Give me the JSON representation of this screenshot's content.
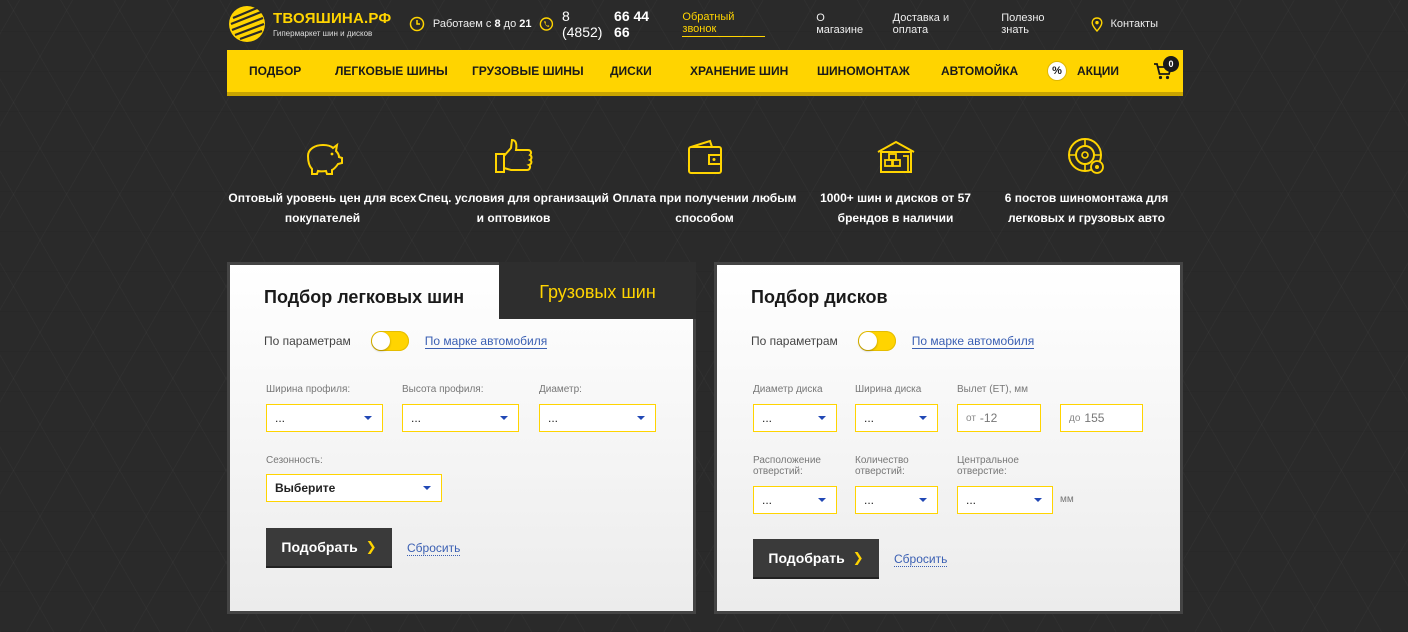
{
  "header": {
    "logo_title": "ТВОЯШИНА.РФ",
    "logo_subtitle": "Гипермаркет шин и дисков",
    "work_prefix": "Работаем с",
    "work_from": "8",
    "work_mid": "до",
    "work_to": "21",
    "phone_code": "8 (4852)",
    "phone_number": "66 44 66",
    "callback_label": "Обратный звонок",
    "links": [
      "О магазине",
      "Доставка и оплата",
      "Полезно знать"
    ],
    "contacts_label": "Контакты"
  },
  "nav": {
    "items": [
      "ПОДБОР",
      "ЛЕГКОВЫЕ ШИНЫ",
      "ГРУЗОВЫЕ ШИНЫ",
      "ДИСКИ",
      "ХРАНЕНИЕ ШИН",
      "ШИНОМОНТАЖ",
      "АВТОМОЙКА"
    ],
    "promo_icon_text": "%",
    "promo_label": "АКЦИИ",
    "cart_count": "0"
  },
  "features": [
    {
      "icon": "piggy-bank-icon",
      "text": "Оптовый уровень цен для всех покупателей"
    },
    {
      "icon": "thumbs-up-icon",
      "text": "Спец. условия для организаций и оптовиков"
    },
    {
      "icon": "wallet-icon",
      "text": "Оплата при получении любым способом"
    },
    {
      "icon": "warehouse-icon",
      "text": "1000+ шин и дисков от 57 брендов в наличии"
    },
    {
      "icon": "tire-service-icon",
      "text": "6 постов шиномонтажа для легковых и грузовых авто"
    }
  ],
  "tires": {
    "tab_active": "Подбор легковых шин",
    "tab_inactive": "Грузовых шин",
    "toggle_left": "По параметрам",
    "toggle_right": "По марке автомобиля",
    "width_label": "Ширина профиля:",
    "width_value": "...",
    "height_label": "Высота профиля:",
    "height_value": "...",
    "diameter_label": "Диаметр:",
    "diameter_value": "...",
    "season_label": "Сезонность:",
    "season_value": "Выберите",
    "submit_label": "Подобрать",
    "reset_label": "Сбросить"
  },
  "disks": {
    "title": "Подбор дисков",
    "toggle_left": "По параметрам",
    "toggle_right": "По марке автомобиля",
    "diameter_label": "Диаметр диска",
    "diameter_value": "...",
    "width_label": "Ширина диска",
    "width_value": "...",
    "offset_label": "Вылет (ET), мм",
    "offset_from_prefix": "от",
    "offset_from_value": "-12",
    "offset_to_prefix": "до",
    "offset_to_value": "155",
    "pcd_label_1": "Расположение",
    "pcd_label_2": "отверстий:",
    "pcd_value": "...",
    "holes_label_1": "Количество",
    "holes_label_2": "отверстий:",
    "holes_value": "...",
    "center_label_1": "Центральное",
    "center_label_2": "отверстие:",
    "center_value": "...",
    "center_unit": "мм",
    "submit_label": "Подобрать",
    "reset_label": "Сбросить"
  }
}
